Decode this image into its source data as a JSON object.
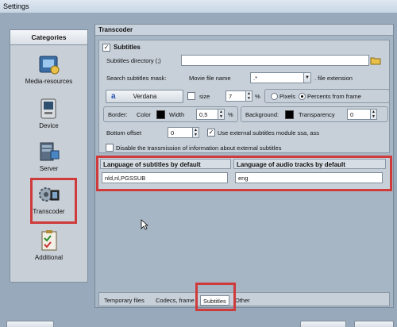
{
  "window": {
    "title": "Settings"
  },
  "categories": {
    "header": "Categories",
    "items": [
      {
        "label": "Media-resources",
        "icon": "media-resources-icon"
      },
      {
        "label": "Device",
        "icon": "device-icon"
      },
      {
        "label": "Server",
        "icon": "server-icon"
      },
      {
        "label": "Transcoder",
        "icon": "transcoder-icon",
        "selected": true
      },
      {
        "label": "Additional",
        "icon": "additional-icon"
      }
    ]
  },
  "main": {
    "header": "Transcoder",
    "subtitles": {
      "section_label": "Subtitles",
      "enabled": true,
      "directory_label": "Subtitles directory (;)",
      "directory_value": "",
      "mask_label": "Search subtitles mask:",
      "movie_file_name_label": "Movie file name",
      "mask_value": ".*",
      "file_extension_label": ". file extension",
      "font_button": "Verdana",
      "size_label": "size",
      "size_value": "7",
      "size_unit": "%",
      "pixels_label": "Pixels",
      "percents_label": "Percents from frame",
      "border_label": "Border:",
      "color_label": "Color",
      "width_label": "Width",
      "width_value": "0,5",
      "width_unit": "%",
      "background_label": "Background:",
      "transparency_label": "Transparency",
      "transparency_value": "0",
      "bottom_offset_label": "Bottom offset",
      "bottom_offset_value": "0",
      "use_external_label": "Use external subtitles module ssa, ass",
      "use_external_checked": true,
      "disable_transmission_label": "Disable the transmission of information about external subtitles",
      "disable_transmission_checked": false
    },
    "languages": {
      "subtitles_header": "Language of subtitles by default",
      "subtitles_value": "nld,nl,PGSSUB",
      "audio_header": "Language of audio tracks by default",
      "audio_value": "eng"
    },
    "tabs": [
      {
        "label": "Temporary files"
      },
      {
        "label": "Codecs, frame"
      },
      {
        "label": "Subtitles",
        "active": true
      },
      {
        "label": "Other"
      }
    ]
  },
  "colors": {
    "highlight": "#cf3a3a",
    "accent": "#3a6ea5"
  }
}
